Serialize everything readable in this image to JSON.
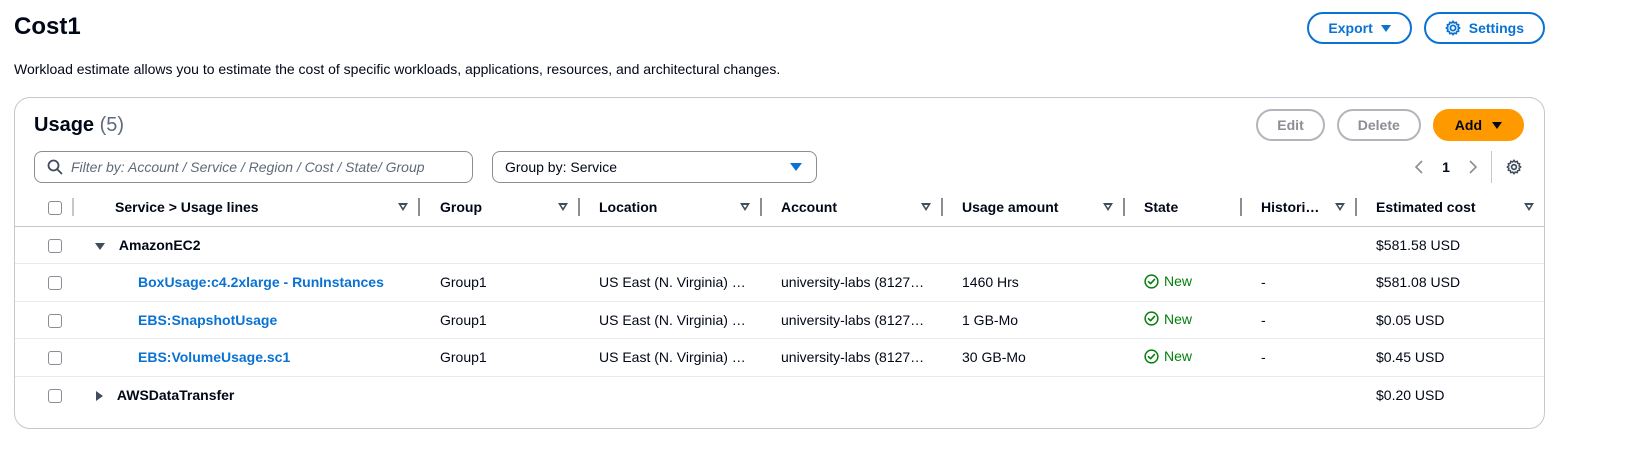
{
  "page": {
    "title": "Cost1",
    "description": "Workload estimate allows you to estimate the cost of specific workloads, applications, resources, and architectural changes.",
    "export_label": "Export",
    "settings_label": "Settings"
  },
  "usage": {
    "title": "Usage",
    "count": "(5)",
    "edit_label": "Edit",
    "delete_label": "Delete",
    "add_label": "Add",
    "filter_placeholder": "Filter by: Account / Service / Region / Cost / State/ Group",
    "group_by": "Group by: Service",
    "page_number": "1",
    "columns": {
      "service": "Service > Usage lines",
      "group": "Group",
      "location": "Location",
      "account": "Account",
      "usage_amount": "Usage amount",
      "state": "State",
      "historic": "Histori…",
      "estimated_cost": "Estimated cost"
    },
    "rows": [
      {
        "name": "AmazonEC2",
        "cost": "$581.58  USD"
      },
      {
        "name": "BoxUsage:c4.2xlarge - RunInstances",
        "group": "Group1",
        "location": "US East (N. Virginia) …",
        "account": "university-labs (8127…",
        "amount": "1460 Hrs",
        "state": "New",
        "historic": "-",
        "cost": "$581.08  USD"
      },
      {
        "name": "EBS:SnapshotUsage",
        "group": "Group1",
        "location": "US East (N. Virginia) …",
        "account": "university-labs (8127…",
        "amount": "1 GB-Mo",
        "state": "New",
        "historic": "-",
        "cost": "$0.05  USD"
      },
      {
        "name": "EBS:VolumeUsage.sc1",
        "group": "Group1",
        "location": "US East (N. Virginia) …",
        "account": "university-labs (8127…",
        "amount": "30 GB-Mo",
        "state": "New",
        "historic": "-",
        "cost": "$0.45  USD"
      },
      {
        "name": "AWSDataTransfer",
        "cost": "$0.20  USD"
      }
    ]
  },
  "colors": {
    "primary_blue": "#0972d3",
    "add_orange": "#ff9900",
    "success_green": "#037f0c"
  }
}
